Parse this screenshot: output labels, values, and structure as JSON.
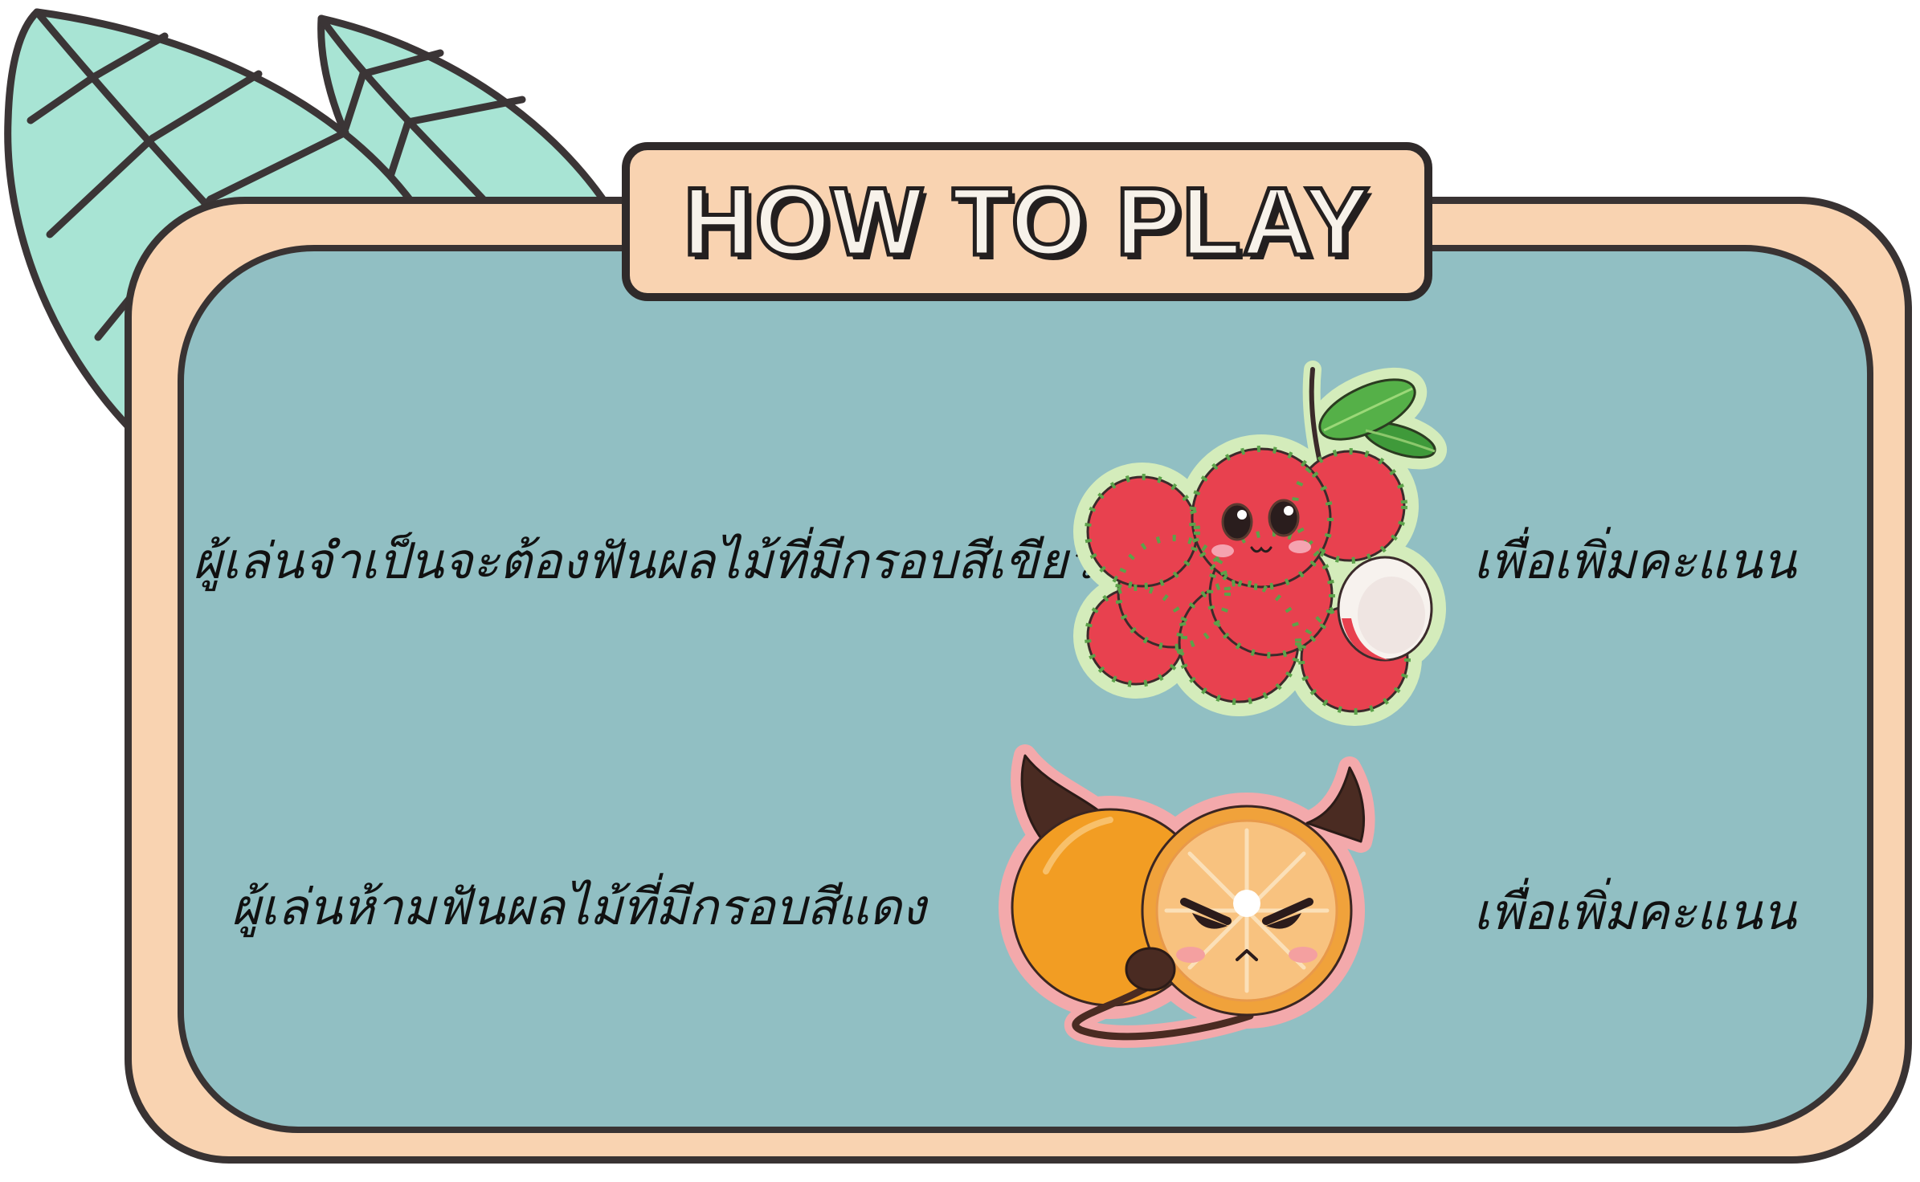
{
  "title": "HOW TO PLAY",
  "rules": [
    {
      "instruction": "ผู้เล่นจำเป็นจะต้องฟันผลไม้ที่มีกรอบสีเขียว",
      "fruit_icon": "rambutan-icon",
      "outline_color": "#d4ecbb",
      "result": "เพื่อเพิ่มคะแนน"
    },
    {
      "instruction": "ผู้เล่นห้ามฟันผลไม้ที่มีกรอบสีแดง",
      "fruit_icon": "devil-orange-icon",
      "outline_color": "#f3a9ab",
      "result": "เพื่อเพิ่มคะแนน"
    }
  ],
  "decoration_icon": "leaf-icon",
  "colors": {
    "panel": "#91bfc3",
    "frame": "#f9d3b1",
    "outline": "#393333",
    "leaf": "#a8e4d4"
  }
}
